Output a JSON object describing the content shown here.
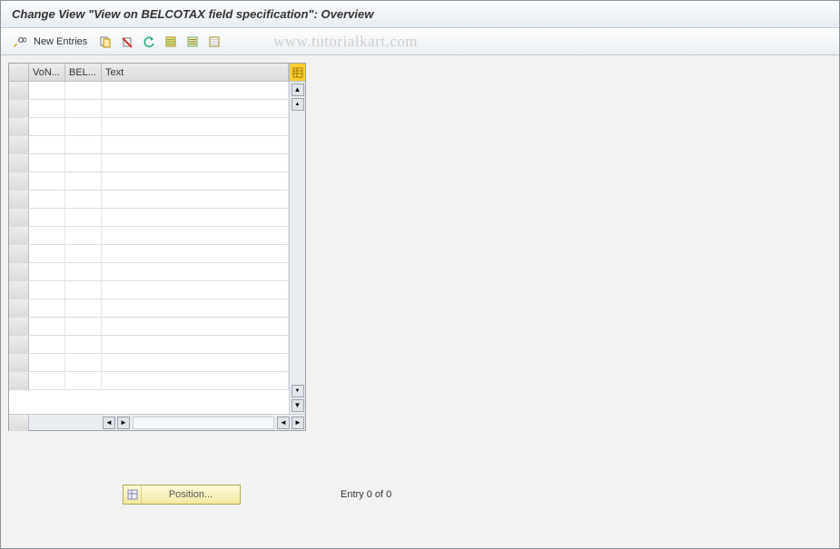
{
  "title": "Change View \"View on BELCOTAX field specification\": Overview",
  "toolbar": {
    "new_entries": "New Entries"
  },
  "watermark": "www.tutorialkart.com",
  "grid": {
    "columns": {
      "sel": "",
      "c1": "VoN...",
      "c2": "BEL...",
      "c3": "Text"
    },
    "row_count": 17
  },
  "footer": {
    "position_label": "Position...",
    "entry_text": "Entry 0 of 0"
  }
}
